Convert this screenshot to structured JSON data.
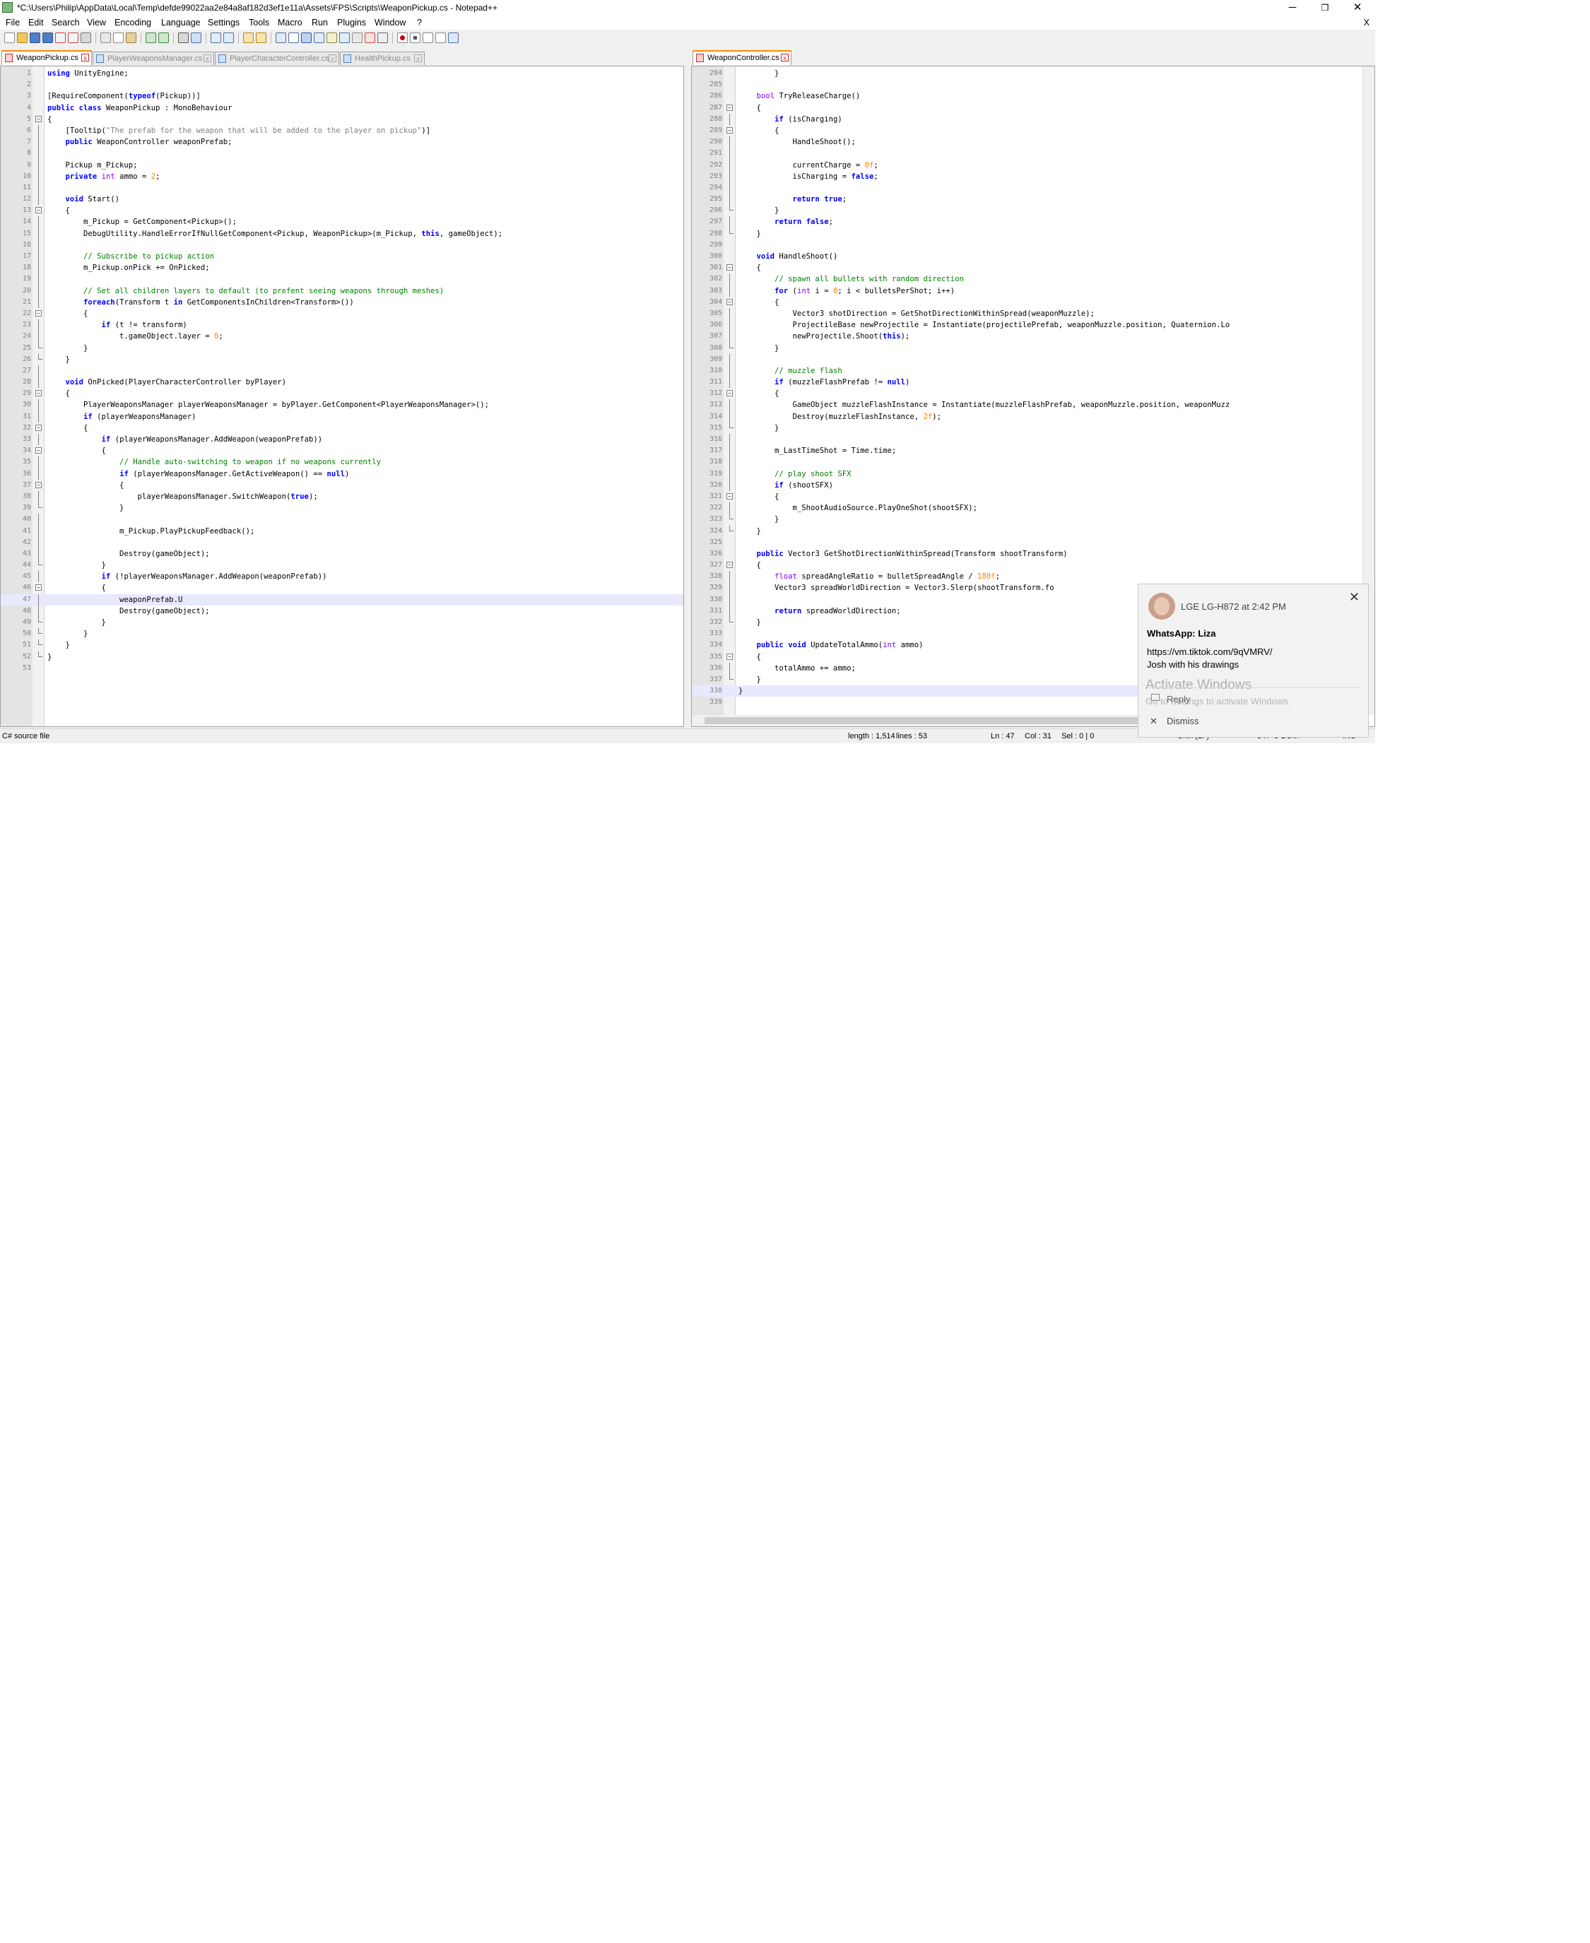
{
  "window": {
    "title": "*C:\\Users\\Philip\\AppData\\Local\\Temp\\defde99022aa2e84a8af182d3ef1e11a\\Assets\\FPS\\Scripts\\WeaponPickup.cs - Notepad++",
    "minimize": "─",
    "restore": "❐",
    "close": "✕"
  },
  "menu": {
    "items": [
      "File",
      "Edit",
      "Search",
      "View",
      "Encoding",
      "Language",
      "Settings",
      "Tools",
      "Macro",
      "Run",
      "Plugins",
      "Window",
      "?"
    ],
    "close_doc": "X"
  },
  "tabs_left": [
    {
      "label": "WeaponPickup.cs",
      "active": true
    },
    {
      "label": "PlayerWeaponsManager.cs",
      "active": false
    },
    {
      "label": "PlayerCharacterController.cs",
      "active": false
    },
    {
      "label": "HealthPickup.cs",
      "active": false
    }
  ],
  "tabs_right": [
    {
      "label": "WeaponController.cs",
      "active": true
    }
  ],
  "left_editor": {
    "first_line": 1,
    "caret_line": 47,
    "lines": [
      "using UnityEngine;",
      "",
      "[RequireComponent(typeof(Pickup))]",
      "public class WeaponPickup : MonoBehaviour",
      "{",
      "    [Tooltip(\"The prefab for the weapon that will be added to the player on pickup\")]",
      "    public WeaponController weaponPrefab;",
      "",
      "    Pickup m_Pickup;",
      "    private int ammo = 2;",
      "",
      "    void Start()",
      "    {",
      "        m_Pickup = GetComponent<Pickup>();",
      "        DebugUtility.HandleErrorIfNullGetComponent<Pickup, WeaponPickup>(m_Pickup, this, gameObject);",
      "",
      "        // Subscribe to pickup action",
      "        m_Pickup.onPick += OnPicked;",
      "",
      "        // Set all children layers to default (to prefent seeing weapons through meshes)",
      "        foreach(Transform t in GetComponentsInChildren<Transform>())",
      "        {",
      "            if (t != transform)",
      "                t.gameObject.layer = 0;",
      "        }",
      "    }",
      "",
      "    void OnPicked(PlayerCharacterController byPlayer)",
      "    {",
      "        PlayerWeaponsManager playerWeaponsManager = byPlayer.GetComponent<PlayerWeaponsManager>();",
      "        if (playerWeaponsManager)",
      "        {",
      "            if (playerWeaponsManager.AddWeapon(weaponPrefab))",
      "            {",
      "                // Handle auto-switching to weapon if no weapons currently",
      "                if (playerWeaponsManager.GetActiveWeapon() == null)",
      "                {",
      "                    playerWeaponsManager.SwitchWeapon(true);",
      "                }",
      "",
      "                m_Pickup.PlayPickupFeedback();",
      "",
      "                Destroy(gameObject);",
      "            }",
      "            if (!playerWeaponsManager.AddWeapon(weaponPrefab))",
      "            {",
      "                weaponPrefab.U",
      "                Destroy(gameObject);",
      "            }",
      "        }",
      "    }",
      "}",
      ""
    ]
  },
  "right_editor": {
    "first_line": 284,
    "caret_line": 338,
    "lines": [
      "        }",
      "",
      "    bool TryReleaseCharge()",
      "    {",
      "        if (isCharging)",
      "        {",
      "            HandleShoot();",
      "",
      "            currentCharge = 0f;",
      "            isCharging = false;",
      "",
      "            return true;",
      "        }",
      "        return false;",
      "    }",
      "",
      "    void HandleShoot()",
      "    {",
      "        // spawn all bullets with random direction",
      "        for (int i = 0; i < bulletsPerShot; i++)",
      "        {",
      "            Vector3 shotDirection = GetShotDirectionWithinSpread(weaponMuzzle);",
      "            ProjectileBase newProjectile = Instantiate(projectilePrefab, weaponMuzzle.position, Quaternion.Lo",
      "            newProjectile.Shoot(this);",
      "        }",
      "",
      "        // muzzle flash",
      "        if (muzzleFlashPrefab != null)",
      "        {",
      "            GameObject muzzleFlashInstance = Instantiate(muzzleFlashPrefab, weaponMuzzle.position, weaponMuzz",
      "            Destroy(muzzleFlashInstance, 2f);",
      "        }",
      "",
      "        m_LastTimeShot = Time.time;",
      "",
      "        // play shoot SFX",
      "        if (shootSFX)",
      "        {",
      "            m_ShootAudioSource.PlayOneShot(shootSFX);",
      "        }",
      "    }",
      "",
      "    public Vector3 GetShotDirectionWithinSpread(Transform shootTransform)",
      "    {",
      "        float spreadAngleRatio = bulletSpreadAngle / 180f;",
      "        Vector3 spreadWorldDirection = Vector3.Slerp(shootTransform.fo",
      "",
      "        return spreadWorldDirection;",
      "    }",
      "",
      "    public void UpdateTotalAmmo(int ammo)",
      "    {",
      "        totalAmmo += ammo;",
      "    }",
      "}",
      ""
    ]
  },
  "status": {
    "file_type": "C# source file",
    "length": "length : 1,514",
    "lines": "lines : 53",
    "ln": "Ln : 47",
    "col": "Col : 31",
    "sel": "Sel : 0 | 0",
    "eol": "Unix (LF)",
    "encoding": "UTF-8-BOM",
    "mode": "INS"
  },
  "notification": {
    "sender": "LGE LG-H872 at 2:42 PM",
    "title": "WhatsApp: Liza",
    "message_1": "https://vm.tiktok.com/9qVMRV/",
    "message_2": "Josh with his drawings",
    "reply": "Reply",
    "dismiss": "Dismiss",
    "watermark_1": "Activate Windows",
    "watermark_2": "Go to Settings to activate Windows."
  }
}
